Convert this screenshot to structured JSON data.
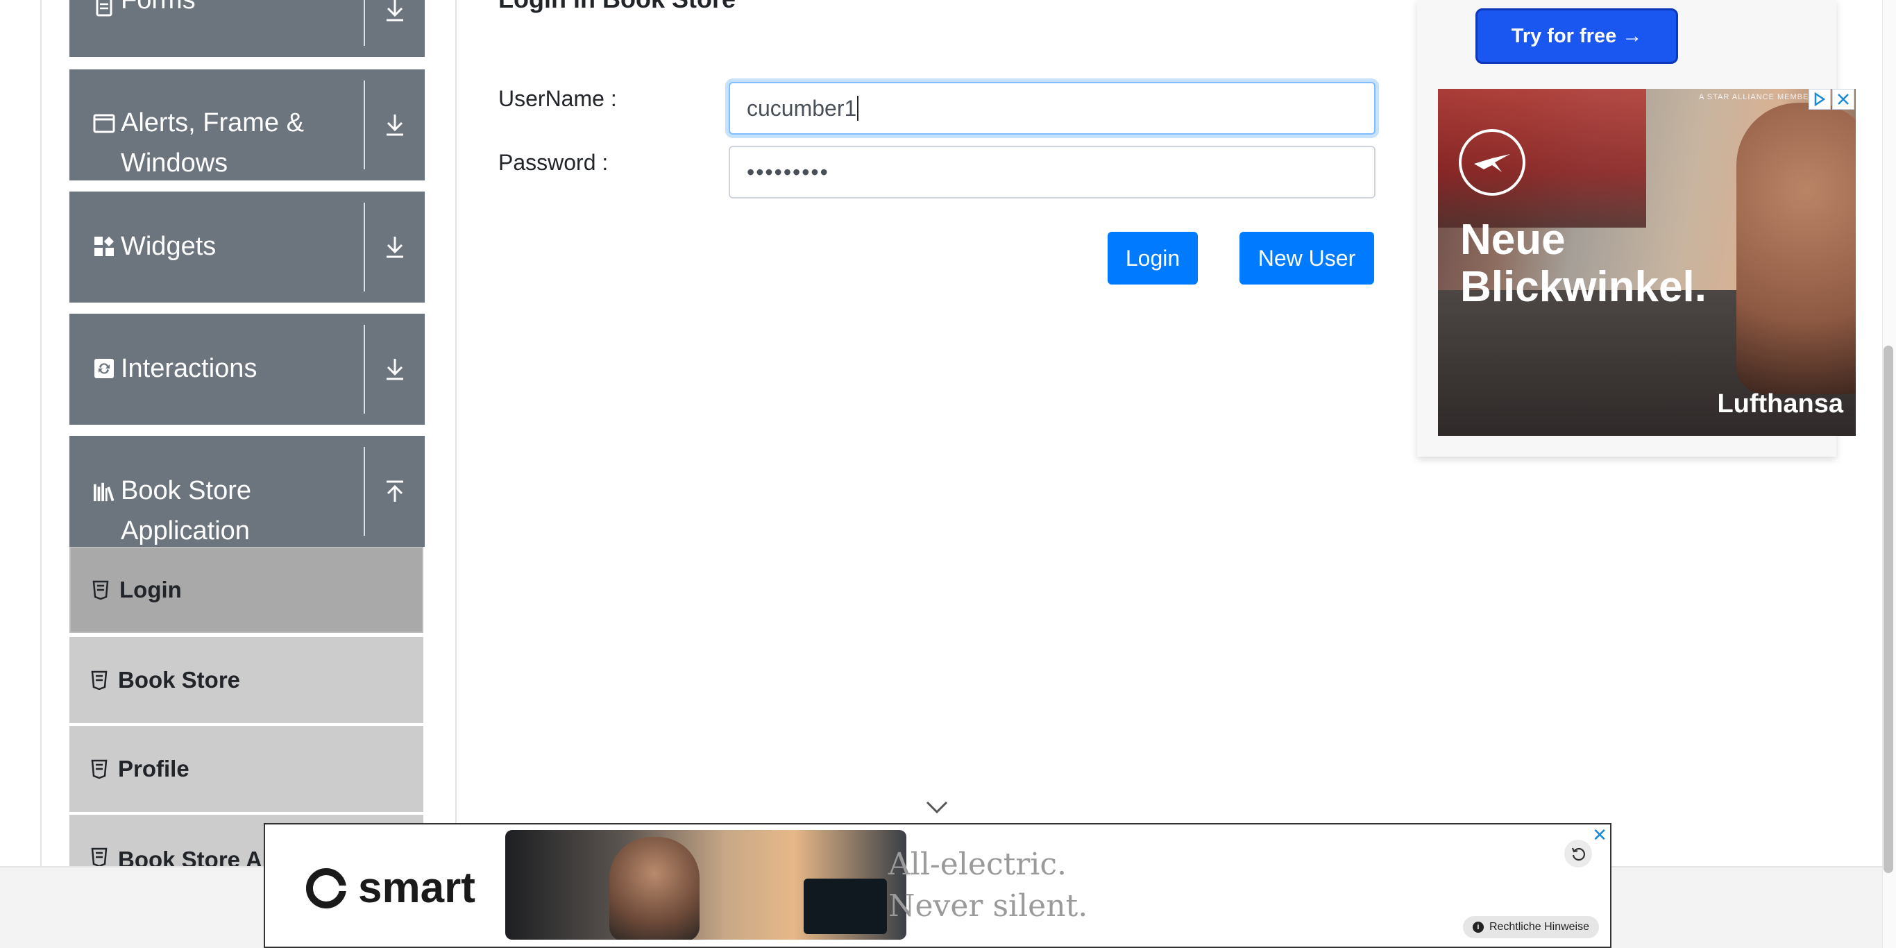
{
  "sidebar": {
    "groups": [
      {
        "label": "Forms",
        "icon": "form-icon",
        "arrow": "down"
      },
      {
        "label": "Alerts, Frame & Windows",
        "label_line1": "Alerts, Frame &",
        "label_line2": "Windows",
        "icon": "window-icon",
        "arrow": "down"
      },
      {
        "label": "Widgets",
        "icon": "widgets-icon",
        "arrow": "down"
      },
      {
        "label": "Interactions",
        "icon": "interactions-icon",
        "arrow": "down"
      },
      {
        "label": "Book Store Application",
        "label_line1": "Book Store",
        "label_line2": "Application",
        "icon": "books-icon",
        "arrow": "up"
      }
    ],
    "book_store_items": [
      {
        "label": "Login",
        "active": true
      },
      {
        "label": "Book Store",
        "active": false
      },
      {
        "label": "Profile",
        "active": false
      },
      {
        "label": "Book Store API",
        "active": false
      }
    ]
  },
  "form": {
    "title": "Login in Book Store",
    "username_label": "UserName :",
    "username_value": "cucumber1",
    "password_label": "Password :",
    "password_value": "•••••••••",
    "login_button": "Login",
    "new_user_button": "New User"
  },
  "right_ad": {
    "try_button": "Try for free →",
    "star_alliance": "A STAR ALLIANCE MEMBER",
    "headline_line1": "Neue",
    "headline_line2": "Blickwinkel.",
    "brand": "Lufthansa"
  },
  "bottom_ad": {
    "brand": "smart",
    "tagline_line1": "All-electric.",
    "tagline_line2": "Never silent.",
    "legal": "Rechtliche Hinweise"
  },
  "colors": {
    "primary": "#007bff",
    "sidebar_header": "#6c757d",
    "menu_item": "#cccccc",
    "menu_item_active": "#a9a9a9"
  }
}
